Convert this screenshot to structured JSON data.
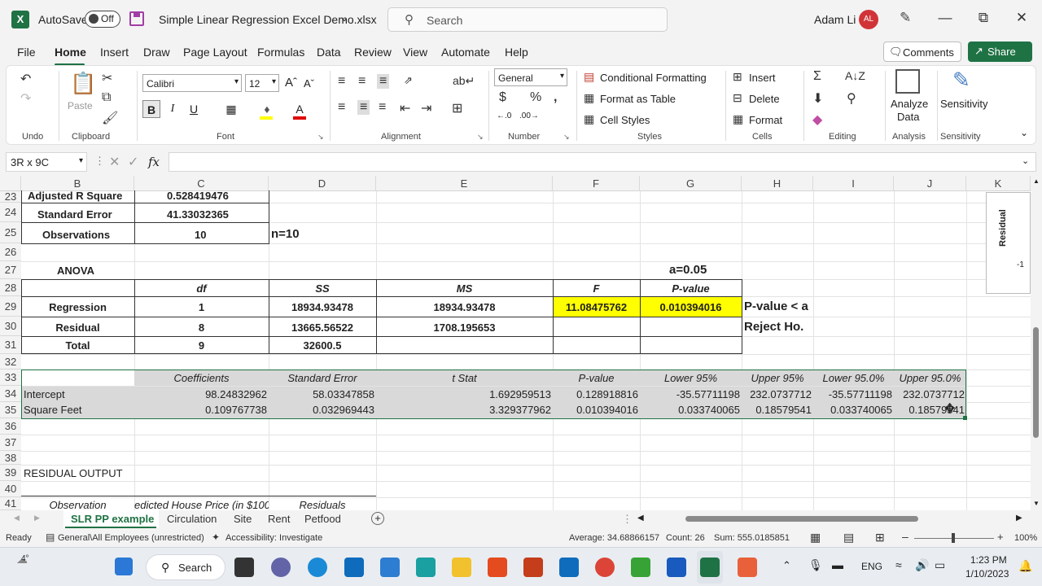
{
  "titlebar": {
    "autosave_label": "AutoSave",
    "autosave_state": "Off",
    "filename": "Simple Linear Regression Excel Demo.xlsx",
    "search_placeholder": "Search",
    "user_name": "Adam Li",
    "user_initials": "AL"
  },
  "menu": {
    "tabs": [
      "File",
      "Home",
      "Insert",
      "Draw",
      "Page Layout",
      "Formulas",
      "Data",
      "Review",
      "View",
      "Automate",
      "Help"
    ],
    "comments_label": "Comments",
    "share_label": "Share"
  },
  "ribbon": {
    "groups": {
      "undo": "Undo",
      "clipboard": "Clipboard",
      "font": "Font",
      "alignment": "Alignment",
      "number": "Number",
      "styles": "Styles",
      "cells": "Cells",
      "editing": "Editing",
      "analysis": "Analysis",
      "sensitivity": "Sensitivity"
    },
    "paste_label": "Paste",
    "font_name": "Calibri",
    "font_size": "12",
    "number_format": "General",
    "conditional_formatting": "Conditional Formatting",
    "format_as_table": "Format as Table",
    "cell_styles": "Cell Styles",
    "insert": "Insert",
    "delete": "Delete",
    "format": "Format",
    "analyze_data_1": "Analyze",
    "analyze_data_2": "Data",
    "sensitivity_btn": "Sensitivity"
  },
  "formula_bar": {
    "name_box": "3R x 9C",
    "fx": "fx",
    "formula": ""
  },
  "columns": [
    "B",
    "C",
    "D",
    "E",
    "F",
    "G",
    "H",
    "I",
    "J",
    "K"
  ],
  "rows": [
    "23",
    "24",
    "25",
    "26",
    "27",
    "28",
    "29",
    "30",
    "31",
    "32",
    "33",
    "34",
    "35",
    "36",
    "37",
    "38",
    "39",
    "40",
    "41"
  ],
  "sheet": {
    "adj_r_square_label": "Adjusted R Square",
    "adj_r_square_value": "0.528419476",
    "std_error_label": "Standard Error",
    "std_error_value": "41.33032365",
    "observations_label": "Observations",
    "observations_value": "10",
    "n_note": "n=10",
    "anova_label": "ANOVA",
    "alpha_note": "a=0.05",
    "anova_headers": [
      "df",
      "SS",
      "MS",
      "F",
      "P-value"
    ],
    "anova_rows": [
      {
        "label": "Regression",
        "df": "1",
        "ss": "18934.93478",
        "ms": "18934.93478",
        "f": "11.08475762",
        "p": "0.010394016"
      },
      {
        "label": "Residual",
        "df": "8",
        "ss": "13665.56522",
        "ms": "1708.195653",
        "f": "",
        "p": ""
      },
      {
        "label": "Total",
        "df": "9",
        "ss": "32600.5",
        "ms": "",
        "f": "",
        "p": ""
      }
    ],
    "pvalue_note_1": "P-value < a",
    "pvalue_note_2": "Reject Ho.",
    "coef_headers": [
      "Coefficients",
      "Standard Error",
      "t Stat",
      "P-value",
      "Lower 95%",
      "Upper 95%",
      "Lower 95.0%",
      "Upper 95.0%"
    ],
    "coef_rows": [
      {
        "label": "Intercept",
        "values": [
          "98.24832962",
          "58.03347858",
          "1.692959513",
          "0.128918816",
          "-35.57711198",
          "232.0737712",
          "-35.57711198",
          "232.0737712"
        ]
      },
      {
        "label": "Square Feet",
        "values": [
          "0.109767738",
          "0.032969443",
          "3.329377962",
          "0.010394016",
          "0.033740065",
          "0.18579541",
          "0.033740065",
          "0.18579541"
        ]
      }
    ],
    "residual_output_label": "RESIDUAL OUTPUT",
    "residual_headers": [
      "Observation",
      "edicted House Price (in $100(",
      "Residuals"
    ],
    "chart_fragment_label": "Residual",
    "chart_fragment_tick": "-1"
  },
  "sheet_tabs": [
    "SLR PP example",
    "Circulation",
    "Site",
    "Rent",
    "Petfood"
  ],
  "status": {
    "ready": "Ready",
    "sensitivity": "General\\All Employees (unrestricted)",
    "accessibility": "Accessibility: Investigate",
    "average": "Average: 34.68866157",
    "count": "Count: 26",
    "sum": "Sum: 555.0185851",
    "zoom": "100%"
  },
  "taskbar": {
    "weather": "4°",
    "search_label": "Search",
    "language": "ENG",
    "time": "1:23 PM",
    "date": "1/10/2023"
  },
  "colors": {
    "excel_green": "#1f7244",
    "highlight_yellow": "#ffff00",
    "avatar_red": "#d13438"
  }
}
